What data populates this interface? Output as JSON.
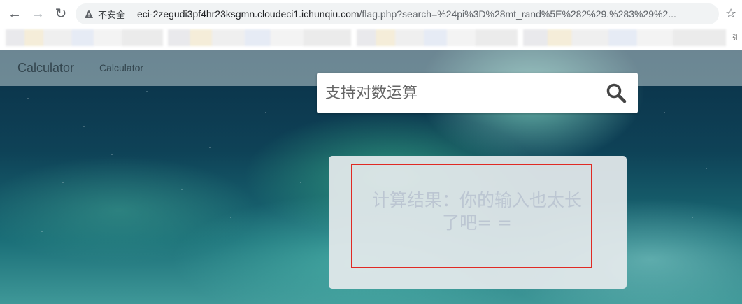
{
  "browser": {
    "security_label": "不安全",
    "url_host": "eci-2zegudi3pf4hr23ksgmn.cloudeci1.ichunqiu.com",
    "url_path": "/flag.php?search=%24pi%3D%28mt_rand%5E%282%29.%283%29%2...",
    "bookmarks_overflow": "引"
  },
  "site": {
    "brand": "Calculator",
    "nav_link": "Calculator"
  },
  "search": {
    "placeholder": "支持对数运算"
  },
  "result": {
    "text": "计算结果：你的输入也太长了吧= ="
  },
  "colors": {
    "highlight_border": "#e02a24"
  }
}
